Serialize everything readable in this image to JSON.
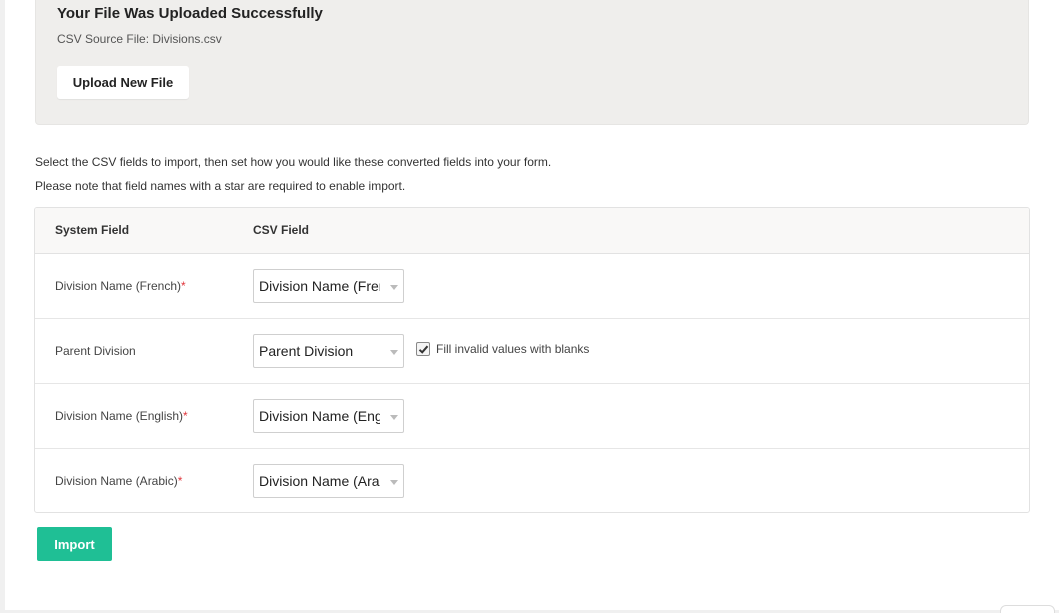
{
  "upload": {
    "title": "Your File Was Uploaded Successfully",
    "source_file": "CSV Source File: Divisions.csv",
    "upload_button": "Upload New File"
  },
  "instructions": {
    "line1": "Select the CSV fields to import, then set how you would like these converted fields into your form.",
    "line2": "Please note that field names with a star are required to enable import."
  },
  "table": {
    "headers": {
      "system_field": "System Field",
      "csv_field": "CSV Field"
    },
    "rows": [
      {
        "label": "Division Name (French)",
        "required": "*",
        "selected": "Division Name (French)"
      },
      {
        "label": "Parent Division",
        "required": "",
        "selected": "Parent Division",
        "option_label": "Fill invalid values with blanks",
        "option_checked": true
      },
      {
        "label": "Division Name (English)",
        "required": "*",
        "selected": "Division Name (English)"
      },
      {
        "label": "Division Name (Arabic)",
        "required": "*",
        "selected": "Division Name (Arabic)"
      }
    ]
  },
  "import_button": "Import",
  "colors": {
    "accent": "#1fbf95",
    "required": "#e0353b",
    "panel_bg": "#efeeec"
  },
  "icons": {
    "select_caret": "caret-down-icon",
    "checkbox_check": "checkmark-icon"
  }
}
